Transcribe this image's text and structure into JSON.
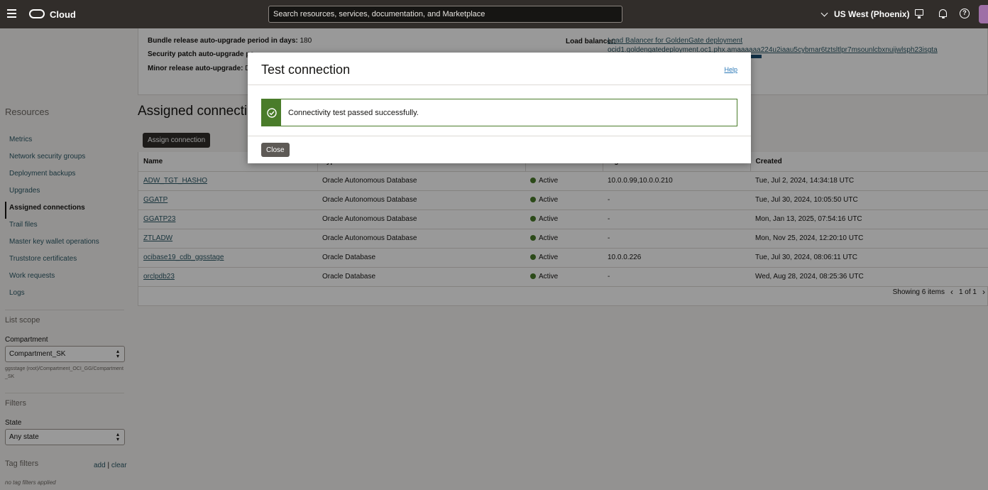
{
  "topbar": {
    "brand": "Cloud",
    "search_placeholder": "Search resources, services, documentation, and Marketplace",
    "region": "US West (Phoenix)"
  },
  "sidebar": {
    "title": "Resources",
    "items": [
      {
        "label": "Metrics"
      },
      {
        "label": "Network security groups"
      },
      {
        "label": "Deployment backups"
      },
      {
        "label": "Upgrades"
      },
      {
        "label": "Assigned connections",
        "active": true
      },
      {
        "label": "Trail files"
      },
      {
        "label": "Master key wallet operations"
      },
      {
        "label": "Truststore certificates"
      },
      {
        "label": "Work requests"
      },
      {
        "label": "Logs"
      }
    ],
    "list_scope": "List scope",
    "compartment_label": "Compartment",
    "compartment_value": "Compartment_SK",
    "compartment_path": "ggsstage (root)/Compartment_OCI_GG/Compartment_SK",
    "filters_title": "Filters",
    "state_label": "State",
    "state_value": "Any state",
    "tag_filters": "Tag filters",
    "tag_add": "add",
    "tag_sep": "|",
    "tag_clear": "clear",
    "no_tag": "no tag filters applied"
  },
  "details": {
    "bundle_label": "Bundle release auto-upgrade period in days:",
    "bundle_value": "180",
    "security_label": "Security patch auto-upgrade pe",
    "minor_label": "Minor release auto-upgrade:",
    "minor_value": "Dis",
    "lb_label": "Load balancer:",
    "lb_link": "Load Balancer for GoldenGate deployment",
    "lb_ocid": "ocid1.goldengatedeployment.oc1.phx.amaaaaaa224u2iaau5cybmar6tztsltlpr7msounlcbxnuijwlsph23isgta"
  },
  "main": {
    "section_title": "Assigned connecti",
    "assign_button": "Assign connection",
    "columns": [
      "Name",
      "Type",
      "State",
      "Ingress IPs",
      "Created"
    ],
    "rows": [
      {
        "name": "ADW_TGT_HASHO",
        "type": "Oracle Autonomous Database",
        "state": "Active",
        "ips": "10.0.0.99,10.0.0.210",
        "created": "Tue, Jul 2, 2024, 14:34:18 UTC"
      },
      {
        "name": "GGATP",
        "type": "Oracle Autonomous Database",
        "state": "Active",
        "ips": "-",
        "created": "Tue, Jul 30, 2024, 10:05:50 UTC"
      },
      {
        "name": "GGATP23",
        "type": "Oracle Autonomous Database",
        "state": "Active",
        "ips": "-",
        "created": "Mon, Jan 13, 2025, 07:54:16 UTC"
      },
      {
        "name": "ZTLADW",
        "type": "Oracle Autonomous Database",
        "state": "Active",
        "ips": "-",
        "created": "Mon, Nov 25, 2024, 12:20:10 UTC"
      },
      {
        "name": "ocibase19_cdb_ggsstage",
        "type": "Oracle Database",
        "state": "Active",
        "ips": "10.0.0.226",
        "created": "Tue, Jul 30, 2024, 08:06:11 UTC"
      },
      {
        "name": "orclpdb23",
        "type": "Oracle Database",
        "state": "Active",
        "ips": "-",
        "created": "Wed, Aug 28, 2024, 08:25:36 UTC"
      }
    ],
    "showing": "Showing 6 items",
    "page": "1 of 1"
  },
  "modal": {
    "title": "Test connection",
    "help": "Help",
    "message": "Connectivity test passed successfully.",
    "close": "Close"
  },
  "colors": {
    "topbar": "#312d2a",
    "success": "#4a7c2a",
    "link": "#2c5967"
  }
}
